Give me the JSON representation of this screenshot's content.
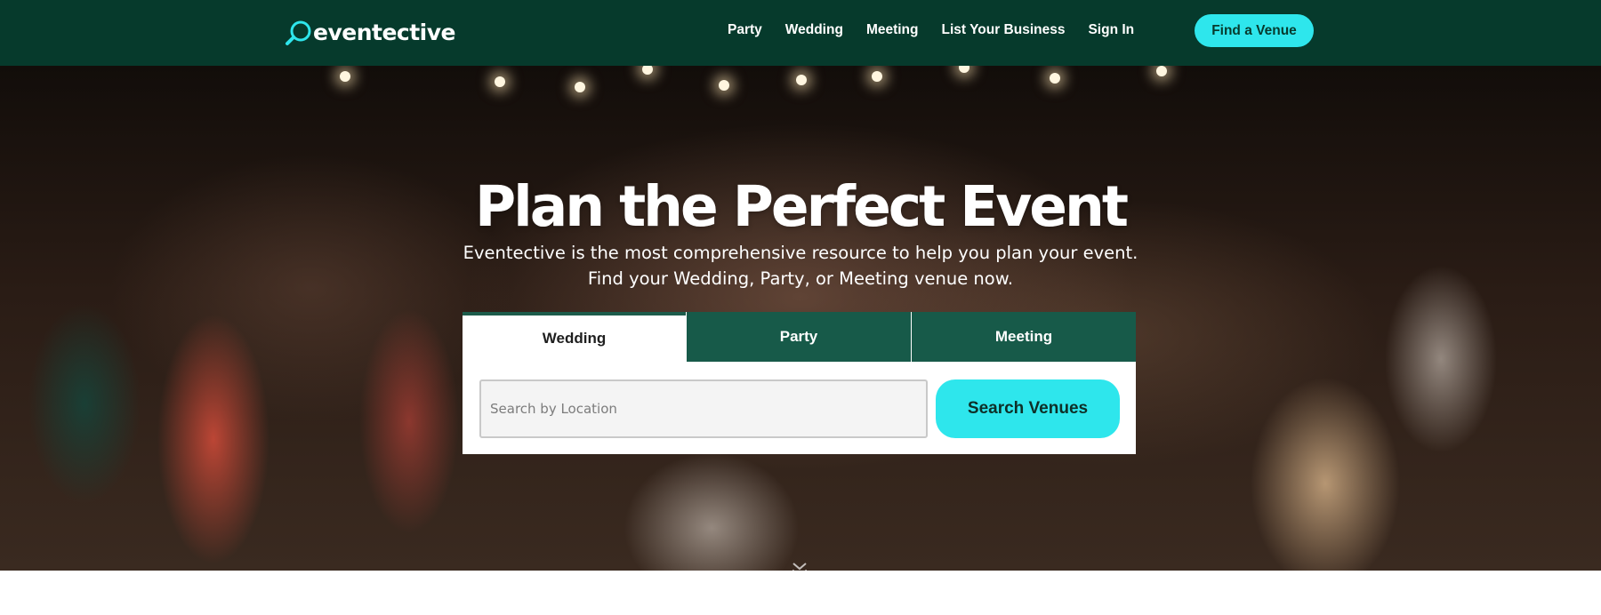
{
  "header": {
    "logo_text": "eventective",
    "nav": [
      {
        "label": "Party"
      },
      {
        "label": "Wedding"
      },
      {
        "label": "Meeting"
      },
      {
        "label": "List Your Business"
      },
      {
        "label": "Sign In"
      }
    ],
    "cta_label": "Find a Venue"
  },
  "hero": {
    "title": "Plan the Perfect Event",
    "subtitle_line1": "Eventective is the most comprehensive resource to help you plan your event.",
    "subtitle_line2": "Find your Wedding, Party, or Meeting venue now."
  },
  "search": {
    "tabs": [
      {
        "label": "Wedding",
        "active": true
      },
      {
        "label": "Party",
        "active": false
      },
      {
        "label": "Meeting",
        "active": false
      }
    ],
    "placeholder": "Search by Location",
    "button_label": "Search Venues"
  },
  "icons": {
    "logo": "magnifier-logo-icon",
    "scroll": "chevron-down-icon"
  },
  "colors": {
    "header_bg": "#063a2c",
    "tab_inactive_bg": "#175a49",
    "accent": "#2ee6ec",
    "white": "#ffffff"
  }
}
